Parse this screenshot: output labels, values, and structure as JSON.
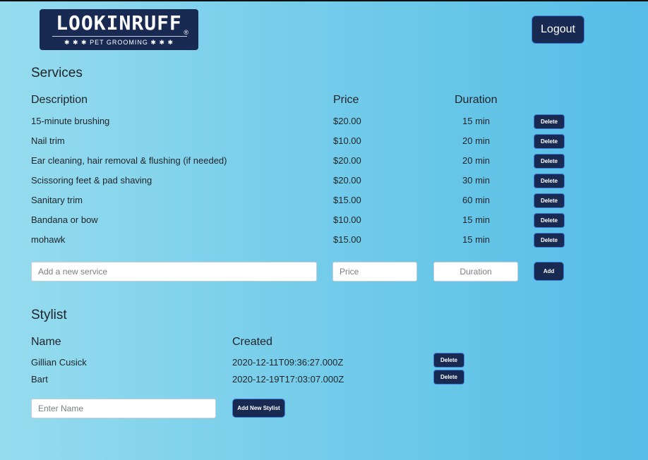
{
  "header": {
    "logo_name": "LOOKINRUFF",
    "logo_reg": "®",
    "logo_tagline": "✱ ✱ ✱  PET GROOMING  ✱ ✱ ✱",
    "logout_label": "Logout"
  },
  "services": {
    "title": "Services",
    "columns": {
      "description": "Description",
      "price": "Price",
      "duration": "Duration"
    },
    "rows": [
      {
        "description": "15-minute brushing",
        "price": "$20.00",
        "duration": "15 min",
        "action": "Delete"
      },
      {
        "description": "Nail trim",
        "price": "$10.00",
        "duration": "20 min",
        "action": "Delete"
      },
      {
        "description": "Ear cleaning, hair removal & flushing (if needed)",
        "price": "$20.00",
        "duration": "20 min",
        "action": "Delete"
      },
      {
        "description": "Scissoring feet & pad shaving",
        "price": "$20.00",
        "duration": "30 min",
        "action": "Delete"
      },
      {
        "description": "Sanitary trim",
        "price": "$15.00",
        "duration": "60 min",
        "action": "Delete"
      },
      {
        "description": "Bandana or bow",
        "price": "$10.00",
        "duration": "15 min",
        "action": "Delete"
      },
      {
        "description": "mohawk",
        "price": "$15.00",
        "duration": "15 min",
        "action": "Delete"
      }
    ],
    "form": {
      "description_value": "",
      "description_placeholder": "Add a new service",
      "price_value": "",
      "price_placeholder": "Price",
      "duration_value": "",
      "duration_placeholder": "Duration",
      "add_label": "Add"
    }
  },
  "stylists": {
    "title": "Stylist",
    "columns": {
      "name": "Name",
      "created": "Created"
    },
    "rows": [
      {
        "name": "Gillian Cusick",
        "created": "2020-12-11T09:36:27.000Z",
        "action": "Delete"
      },
      {
        "name": "Bart",
        "created": "2020-12-19T17:03:07.000Z",
        "action": "Delete"
      }
    ],
    "form": {
      "name_value": "",
      "name_placeholder": "Enter Name",
      "add_label": "Add New Stylist"
    }
  },
  "colors": {
    "navy": "#192a52",
    "button_border": "#3d7bd9",
    "bg_start": "#96dcef",
    "bg_end": "#55bde6"
  }
}
